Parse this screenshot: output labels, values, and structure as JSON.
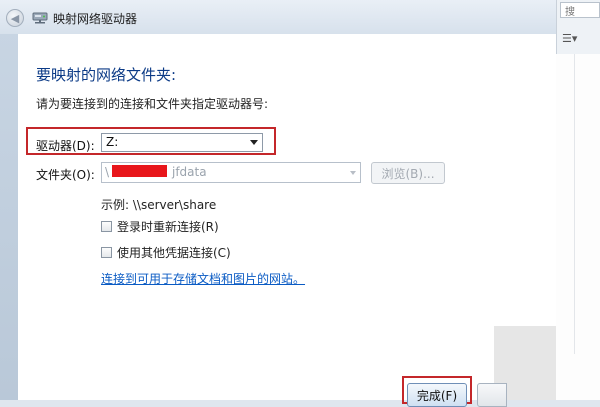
{
  "window": {
    "title": "映射网络驱动器"
  },
  "dialog": {
    "heading": "要映射的网络文件夹:",
    "instruction": "请为要连接到的连接和文件夹指定驱动器号:",
    "drive": {
      "label": "驱动器(D):",
      "value": "Z:"
    },
    "folder": {
      "label": "文件夹(O):",
      "value_prefix": "\\",
      "value_suffix": "jfdata"
    },
    "browse_label": "浏览(B)...",
    "example": "示例: \\\\server\\share",
    "reconnect_label": "登录时重新连接(R)",
    "credentials_label": "使用其他凭据连接(C)",
    "storage_link": "连接到可用于存储文档和图片的网站。",
    "finish_label": "完成(F)"
  },
  "explorer": {
    "search_placeholder": "搜"
  },
  "colors": {
    "heading": "#0b3a86",
    "link": "#0a5bc4",
    "highlight": "#c4272a",
    "redaction": "#e8161b"
  }
}
